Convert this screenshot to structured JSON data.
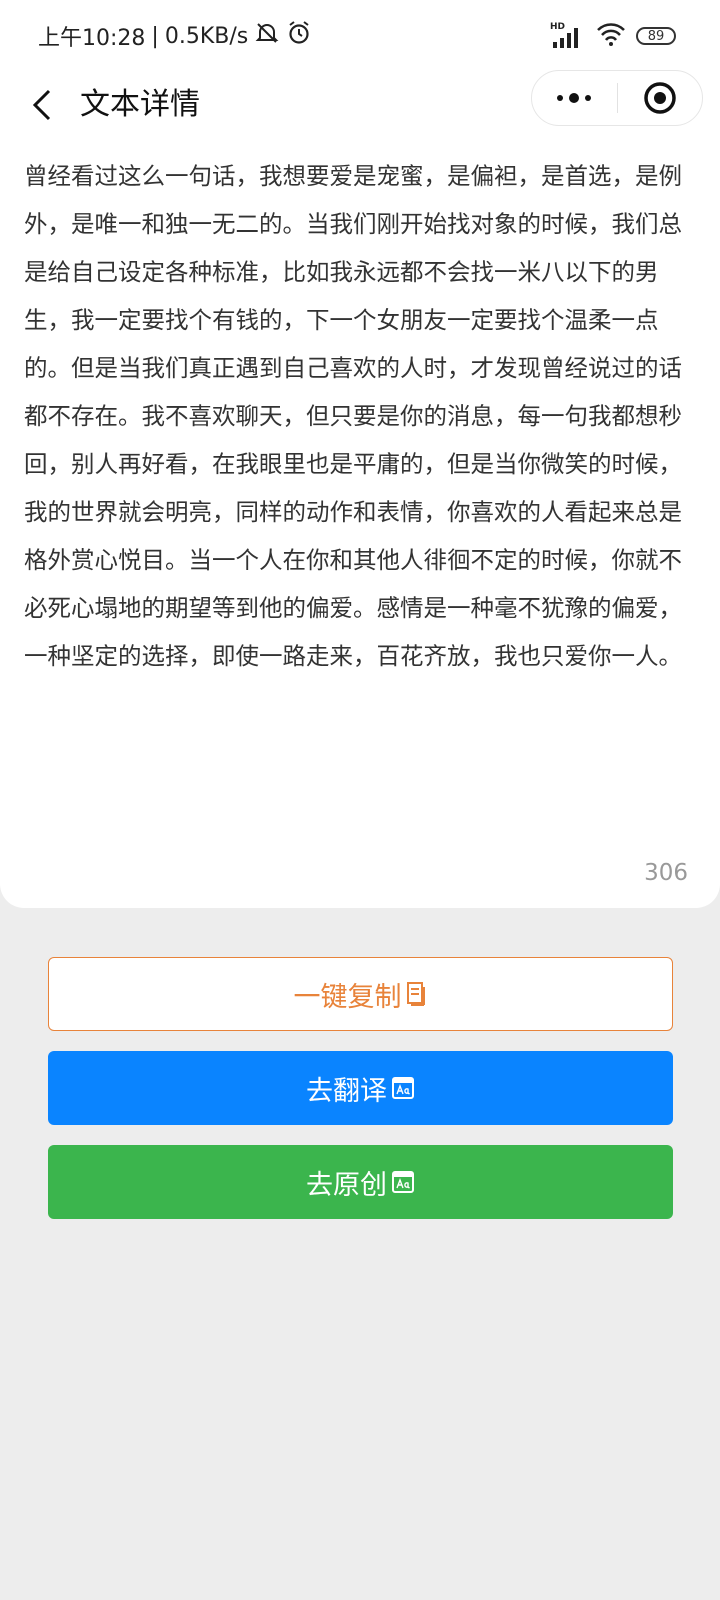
{
  "status_bar": {
    "time_text": "上午10:28",
    "separator": "|",
    "speed_text": "0.5KB/s",
    "hd_label": "HD",
    "battery_level": "89",
    "icons": [
      "mute-bell-icon",
      "alarm-icon",
      "signal-icon",
      "wifi-icon",
      "battery-icon"
    ]
  },
  "nav": {
    "title": "文本详情",
    "back_icon": "chevron-left-icon",
    "more_icon": "more-dots-icon",
    "close_icon": "target-close-icon"
  },
  "content": {
    "text": "曾经看过这么一句话，我想要爱是宠蜜，是偏袒，是首选，是例外，是唯一和独一无二的。当我们刚开始找对象的时候，我们总是给自己设定各种标准，比如我永远都不会找一米八以下的男生，我一定要找个有钱的，下一个女朋友一定要找个温柔一点的。但是当我们真正遇到自己喜欢的人时，才发现曾经说过的话都不存在。我不喜欢聊天，但只要是你的消息，每一句我都想秒回，别人再好看，在我眼里也是平庸的，但是当你微笑的时候，我的世界就会明亮，同样的动作和表情，你喜欢的人看起来总是格外赏心悦目。当一个人在你和其他人徘徊不定的时候，你就不必死心塌地的期望等到他的偏爱。感情是一种毫不犹豫的偏爱，一种坚定的选择，即使一路走来，百花齐放，我也只爱你一人。",
    "char_count": "306"
  },
  "buttons": {
    "copy_label": "一键复制",
    "translate_label": "去翻译",
    "original_label": "去原创"
  },
  "colors": {
    "copy_accent": "#e8833a",
    "translate_bg": "#0a84ff",
    "original_bg": "#3bb54d",
    "page_bg": "#ededed"
  }
}
